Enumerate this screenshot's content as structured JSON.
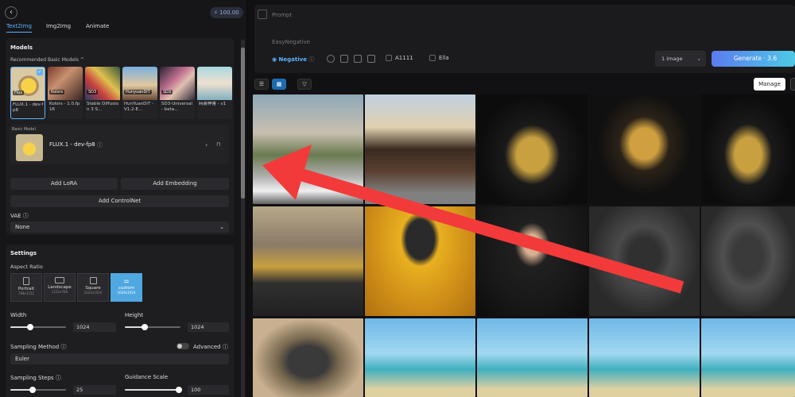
{
  "header": {
    "credits": "100.00",
    "tabs": [
      "Text2Img",
      "Img2Img",
      "Animate"
    ]
  },
  "models": {
    "title": "Models",
    "recommended_label": "Recommended Basic Models",
    "items": [
      {
        "badge": "Flux",
        "name": "FLUX.1 - dev-fp8",
        "selected": true
      },
      {
        "badge": "Kolors",
        "name": "Kolors - 1.0.fp16"
      },
      {
        "badge": "SD3",
        "name": "Stable Diffusion 3 S..."
      },
      {
        "badge": "HunyuanDiT",
        "name": "HunYuanDiT - V1.2-E..."
      },
      {
        "badge": "SD3",
        "name": "SD3-Universal - beta..."
      },
      {
        "badge": "",
        "name": "時装神書 - v1"
      }
    ],
    "base_label": "Basic Model",
    "base_value": "FLUX.1 - dev-fp8"
  },
  "buttons": {
    "add_lora": "Add LoRA",
    "add_embedding": "Add Embedding",
    "add_controlnet": "Add ControlNet"
  },
  "vae": {
    "label": "VAE",
    "value": "None"
  },
  "settings": {
    "title": "Settings",
    "aspect_label": "Aspect Ratio",
    "aspects": [
      {
        "label": "Portrait",
        "dims": "768x1152"
      },
      {
        "label": "Landscape",
        "dims": "1152x768"
      },
      {
        "label": "Square",
        "dims": "1024x1024"
      },
      {
        "label": "custom",
        "dims": "1024x1024",
        "active": true
      }
    ],
    "width_label": "Width",
    "width_value": "1024",
    "width_frac": 0.35,
    "height_label": "Height",
    "height_value": "1024",
    "height_frac": 0.35,
    "sampling_method_label": "Sampling Method",
    "sampling_method_value": "Euler",
    "advanced_label": "Advanced",
    "steps_label": "Sampling Steps",
    "steps_value": "25",
    "steps_frac": 0.4,
    "guidance_label": "Guidance Scale",
    "guidance_value": "100",
    "guidance_frac": 0.97
  },
  "prompt": {
    "placeholder": "Prompt",
    "negative_text": "EasyNegative",
    "negative_label": "Negative",
    "a1111_label": "A1111",
    "ella_label": "Ella",
    "count_value": "1 image",
    "generate_label": "Generate · 3.6"
  },
  "gallery": {
    "manage_label": "Manage"
  },
  "colors": {
    "accent": "#5ab4ff",
    "generate_start": "#5a7cf0",
    "generate_end": "#4ec9e6",
    "arrow": "#f23a3a"
  }
}
